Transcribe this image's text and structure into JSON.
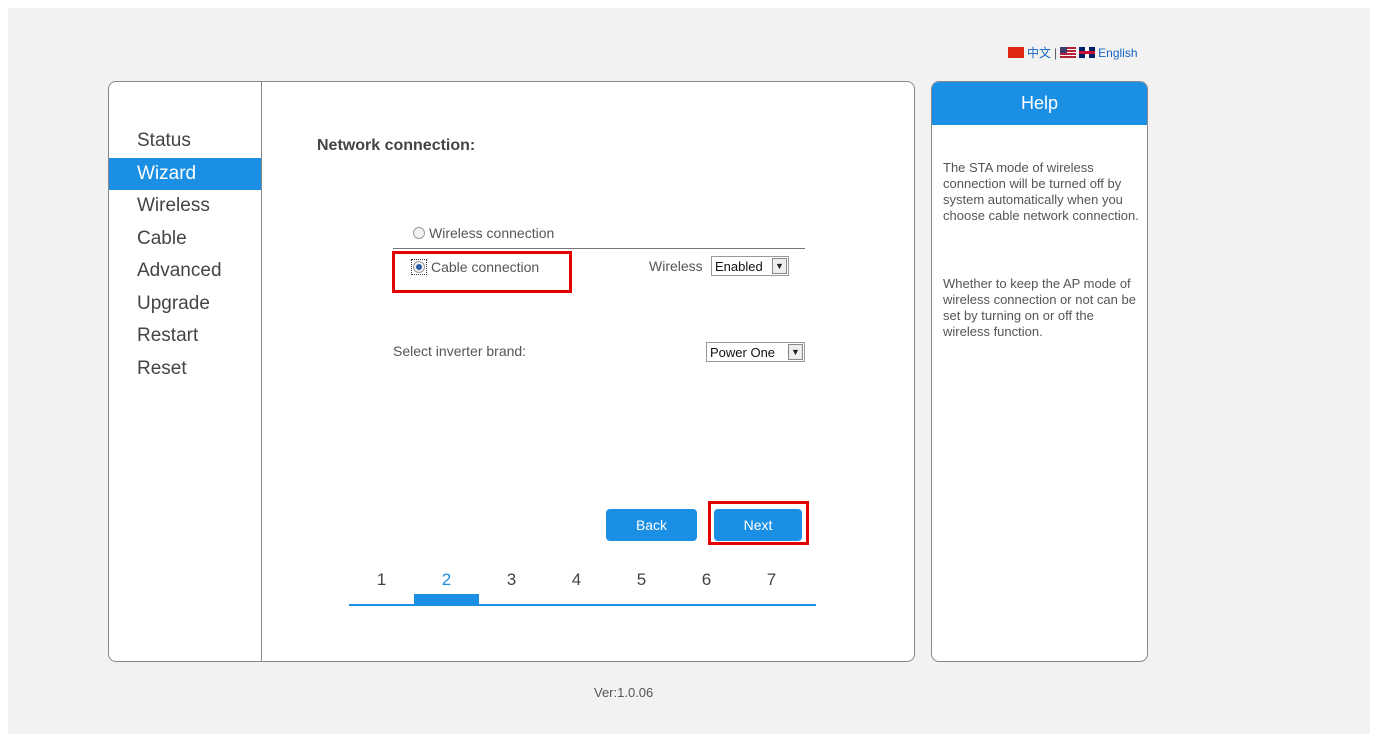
{
  "language": {
    "chinese_label": "中文",
    "separator": "|",
    "english_label": "English"
  },
  "sidebar": {
    "items": [
      {
        "label": "Status"
      },
      {
        "label": "Wizard"
      },
      {
        "label": "Wireless"
      },
      {
        "label": "Cable"
      },
      {
        "label": "Advanced"
      },
      {
        "label": "Upgrade"
      },
      {
        "label": "Restart"
      },
      {
        "label": "Reset"
      }
    ],
    "active": "Wizard"
  },
  "main": {
    "title": "Network connection:",
    "options": {
      "wireless_label": "Wireless connection",
      "cable_label": "Cable connection",
      "selected": "Cable connection"
    },
    "wireless_toggle": {
      "label": "Wireless",
      "value": "Enabled"
    },
    "inverter": {
      "label": "Select inverter brand:",
      "value": "Power One"
    },
    "buttons": {
      "back": "Back",
      "next": "Next"
    },
    "steps": [
      "1",
      "2",
      "3",
      "4",
      "5",
      "6",
      "7"
    ],
    "current_step": "2"
  },
  "help": {
    "title": "Help",
    "paragraph1": "The STA mode of wireless connection will be turned off by system automatically when you choose cable network connection.",
    "paragraph2": "Whether to keep the AP mode of wireless connection or not can be set by turning on or off the wireless function."
  },
  "footer": {
    "version": "Ver:1.0.06"
  },
  "colors": {
    "accent": "#1b8fe4",
    "highlight": "#e20000"
  }
}
